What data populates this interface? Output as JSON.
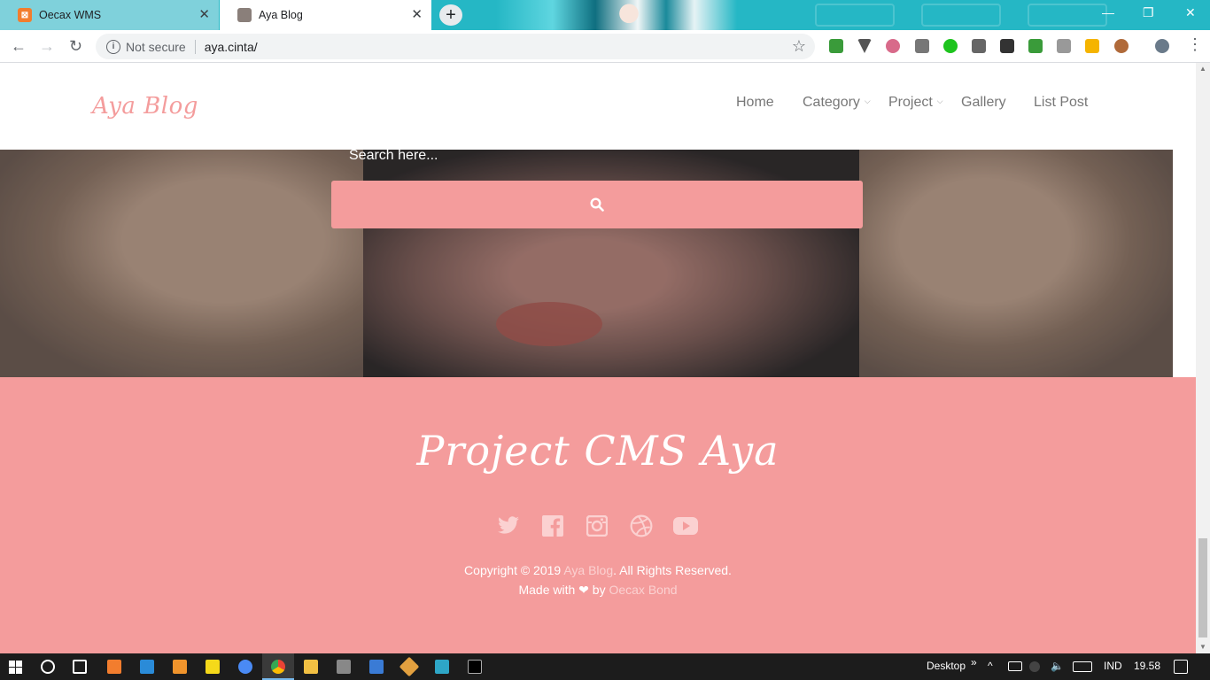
{
  "browser": {
    "tabs": [
      {
        "title": "Oecax WMS",
        "active": false,
        "favicon_color": "#f27d2e"
      },
      {
        "title": "Aya Blog",
        "active": true,
        "favicon_color": "#8a7f7a"
      }
    ],
    "tab_close_glyph": "✕",
    "new_tab_glyph": "+",
    "window_controls": [
      "—",
      "❐",
      "✕"
    ],
    "security_label": "Not secure",
    "url": "aya.cinta/",
    "bookmark_glyph": "☆",
    "nav": {
      "back": "←",
      "forward": "→",
      "reload": "↻"
    }
  },
  "site": {
    "brand": "Aya Blog",
    "menu": [
      {
        "label": "Home",
        "has_dropdown": false
      },
      {
        "label": "Category",
        "has_dropdown": true
      },
      {
        "label": "Project",
        "has_dropdown": true
      },
      {
        "label": "Gallery",
        "has_dropdown": false
      },
      {
        "label": "List Post",
        "has_dropdown": false
      }
    ],
    "dropdown_glyph": "⌵",
    "search_placeholder": "Search here...",
    "search_icon": "search-icon",
    "accent_color": "#f49c9c"
  },
  "footer": {
    "title": "Project CMS Aya",
    "socials": [
      "twitter-icon",
      "facebook-icon",
      "instagram-icon",
      "dribbble-icon",
      "youtube-icon"
    ],
    "copyright_prefix": "Copyright © 2019",
    "copyright_link": "Aya Blog",
    "copyright_suffix": ". All Rights Reserved.",
    "made_with_prefix": "Made with",
    "heart_glyph": "❤",
    "made_with_by": "by",
    "author_link": "Oecax Bond"
  },
  "taskbar": {
    "desktop_label": "Desktop",
    "chevron": "»",
    "language": "IND",
    "time": "19.58"
  }
}
